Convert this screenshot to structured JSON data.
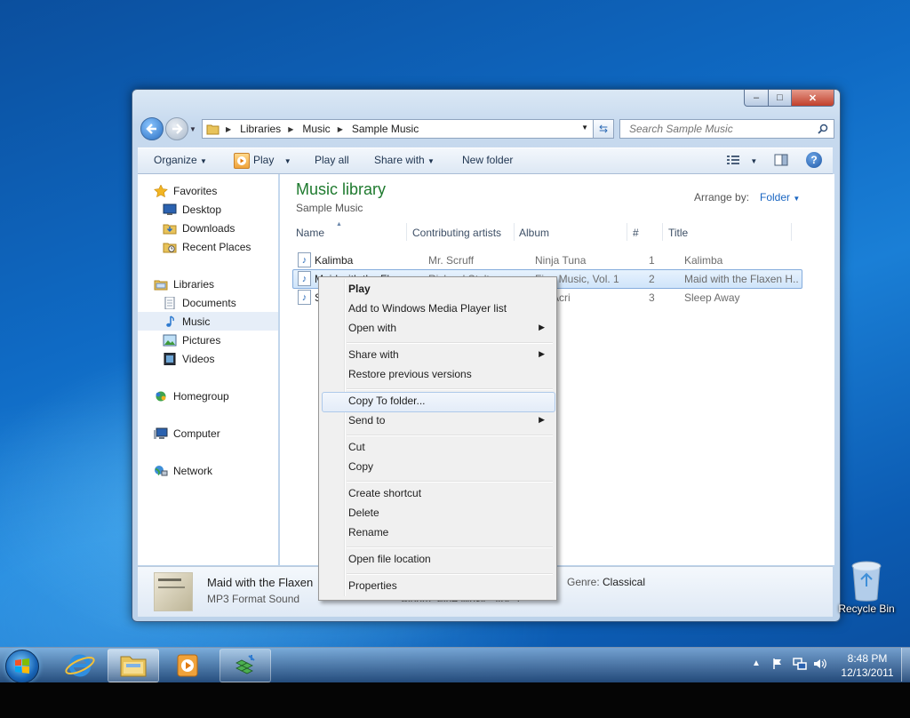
{
  "window": {
    "caption_buttons": {
      "minimize": "–",
      "maximize": "□",
      "close": "✕"
    },
    "breadcrumb": [
      "Libraries",
      "Music",
      "Sample Music"
    ],
    "search_placeholder": "Search Sample Music"
  },
  "toolbar": {
    "organize": "Organize",
    "play": "Play",
    "play_all": "Play all",
    "share_with": "Share with",
    "new_folder": "New folder"
  },
  "nav": {
    "favorites": "Favorites",
    "desktop": "Desktop",
    "downloads": "Downloads",
    "recent_places": "Recent Places",
    "libraries": "Libraries",
    "documents": "Documents",
    "music": "Music",
    "pictures": "Pictures",
    "videos": "Videos",
    "homegroup": "Homegroup",
    "computer": "Computer",
    "network": "Network"
  },
  "library": {
    "title": "Music library",
    "subtitle": "Sample Music",
    "arrange_label": "Arrange by:",
    "arrange_value": "Folder"
  },
  "columns": [
    "Name",
    "Contributing artists",
    "Album",
    "#",
    "Title"
  ],
  "rows": [
    {
      "name": "Kalimba",
      "artist": "Mr. Scruff",
      "album": "Ninja Tuna",
      "num": "1",
      "title": "Kalimba"
    },
    {
      "name": "Maid with the Flaxe",
      "artist": "Richard Stoltzman",
      "album": "Fine Music, Vol. 1",
      "num": "2",
      "title": "Maid with the Flaxen H..."
    },
    {
      "name": "S",
      "artist": "",
      "album": "Acri",
      "num": "3",
      "title": "Sleep Away"
    }
  ],
  "details": {
    "file_name": "Maid with the Flaxen I",
    "file_type": "MP3 Format Sound",
    "album_line": "Album: Fine Music, Vol. 1",
    "genre_label": "Genre:",
    "genre_value": "Classical",
    "dot": "."
  },
  "context_menu": {
    "play": "Play",
    "add_to_wmp": "Add to Windows Media Player list",
    "open_with": "Open with",
    "share_with": "Share with",
    "restore": "Restore previous versions",
    "copy_to_folder": "Copy To folder...",
    "send_to": "Send to",
    "cut": "Cut",
    "copy": "Copy",
    "create_shortcut": "Create shortcut",
    "delete": "Delete",
    "rename": "Rename",
    "open_file_location": "Open file location",
    "properties": "Properties"
  },
  "desktop": {
    "recycle_bin": "Recycle Bin"
  },
  "taskbar": {
    "time": "8:48 PM",
    "date": "12/13/2011"
  }
}
